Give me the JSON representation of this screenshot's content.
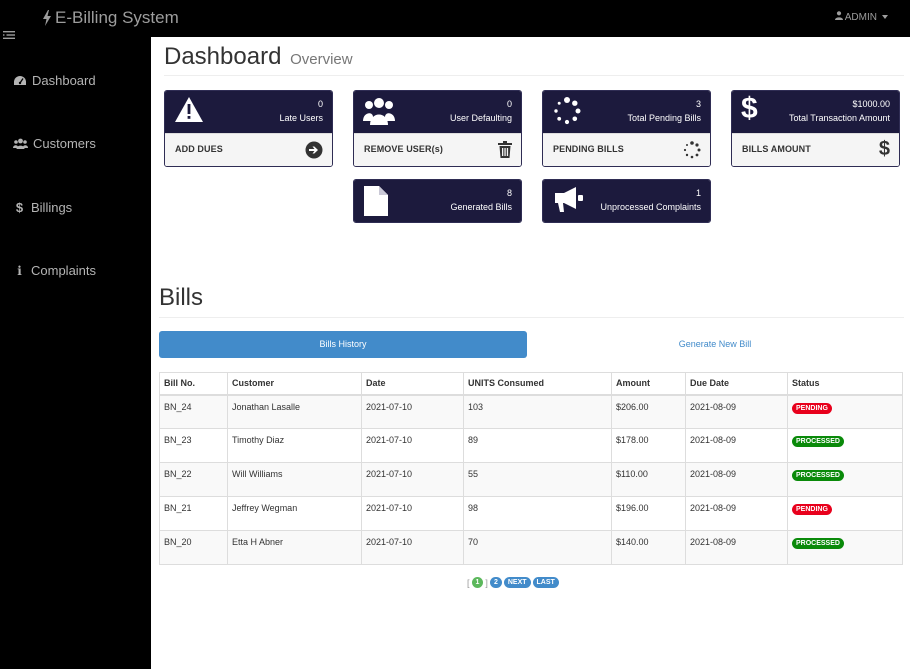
{
  "app": {
    "title": "E-Billing System",
    "user_menu": "ADMIN"
  },
  "sidebar": {
    "items": [
      {
        "label": "Dashboard",
        "icon": "dashboard-icon"
      },
      {
        "label": "Customers",
        "icon": "users-icon"
      },
      {
        "label": "Billings",
        "icon": "dollar-icon"
      },
      {
        "label": "Complaints",
        "icon": "info-icon"
      }
    ]
  },
  "header": {
    "title": "Dashboard",
    "subtitle": "Overview"
  },
  "cards": {
    "late": {
      "count": "0",
      "label": "Late Users",
      "footer": "ADD DUES",
      "icon": "warning-icon",
      "footer_icon": "arrow-circle-right-icon"
    },
    "defaulting": {
      "count": "0",
      "label": "User Defaulting",
      "footer": "REMOVE USER(s)",
      "icon": "users-icon",
      "footer_icon": "trash-icon"
    },
    "pending": {
      "count": "3",
      "label": "Total Pending Bills",
      "footer": "PENDING BILLS",
      "icon": "spinner-icon",
      "footer_icon": "spinner-icon"
    },
    "transaction": {
      "count": "$1000.00",
      "label": "Total Transaction Amount",
      "footer": "BILLS AMOUNT",
      "icon": "dollar-icon",
      "footer_icon": "dollar-icon"
    },
    "generated": {
      "count": "8",
      "label": "Generated Bills",
      "icon": "file-icon"
    },
    "complaints": {
      "count": "1",
      "label": "Unprocessed Complaints",
      "icon": "bullhorn-icon"
    }
  },
  "bills": {
    "title": "Bills",
    "tabs": {
      "active": "Bills History",
      "other": "Generate New Bill"
    },
    "columns": [
      "Bill No.",
      "Customer",
      "Date",
      "UNITS Consumed",
      "Amount",
      "Due Date",
      "Status"
    ],
    "rows": [
      {
        "bill_no": "BN_24",
        "customer": "Jonathan Lasalle",
        "date": "2021-07-10",
        "units": "103",
        "amount": "$206.00",
        "due": "2021-08-09",
        "status": "PENDING"
      },
      {
        "bill_no": "BN_23",
        "customer": "Timothy Diaz",
        "date": "2021-07-10",
        "units": "89",
        "amount": "$178.00",
        "due": "2021-08-09",
        "status": "PROCESSED"
      },
      {
        "bill_no": "BN_22",
        "customer": "Will Williams",
        "date": "2021-07-10",
        "units": "55",
        "amount": "$110.00",
        "due": "2021-08-09",
        "status": "PROCESSED"
      },
      {
        "bill_no": "BN_21",
        "customer": "Jeffrey Wegman",
        "date": "2021-07-10",
        "units": "98",
        "amount": "$196.00",
        "due": "2021-08-09",
        "status": "PENDING"
      },
      {
        "bill_no": "BN_20",
        "customer": "Etta H Abner",
        "date": "2021-07-10",
        "units": "70",
        "amount": "$140.00",
        "due": "2021-08-09",
        "status": "PROCESSED"
      }
    ],
    "status_colors": {
      "PENDING": "#e8001c",
      "PROCESSED": "#0a8a0a"
    }
  },
  "pagination": {
    "open": "[",
    "pages": [
      "1",
      "2"
    ],
    "current": "1",
    "next": "NEXT",
    "last": "LAST"
  }
}
